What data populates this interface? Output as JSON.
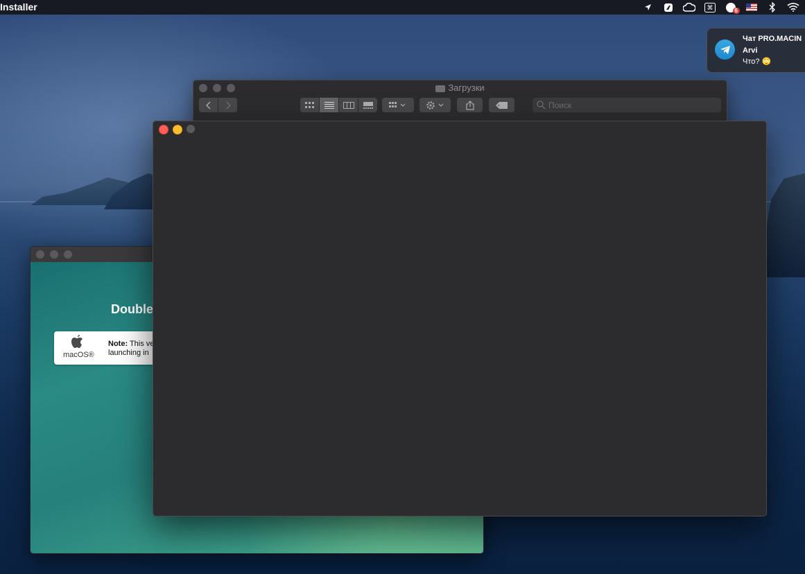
{
  "menubar": {
    "app_name": "Installer",
    "status_icons": [
      "location-arrow-icon",
      "app-status-icon",
      "cloud-icon",
      "cmd-icon",
      "notification-app-icon",
      "us-flag-icon",
      "bluetooth-icon",
      "wifi-icon"
    ],
    "badge_count": "6"
  },
  "notification": {
    "title": "Чат PRO.MACIN",
    "sender": "Arvi",
    "message": "Что? 🙄",
    "icon": "telegram-icon"
  },
  "finder": {
    "title": "Загрузки",
    "search_placeholder": "Поиск",
    "icons": [
      "back-icon",
      "forward-icon",
      "icon-view-icon",
      "list-view-icon",
      "column-view-icon",
      "gallery-view-icon",
      "group-icon",
      "action-gear-icon",
      "share-icon",
      "tag-icon",
      "search-icon"
    ]
  },
  "installer": {
    "title": "Double",
    "note_bold": "Note:",
    "note_line1": " This ve",
    "note_line2": "launching in",
    "macos_label": "macOS®"
  },
  "colors": {
    "menubar": "#171a22",
    "window_bg": "#2c2c2e",
    "close": "#ff5f57",
    "minimize": "#febc2e",
    "installer_teal": "#26807c"
  }
}
